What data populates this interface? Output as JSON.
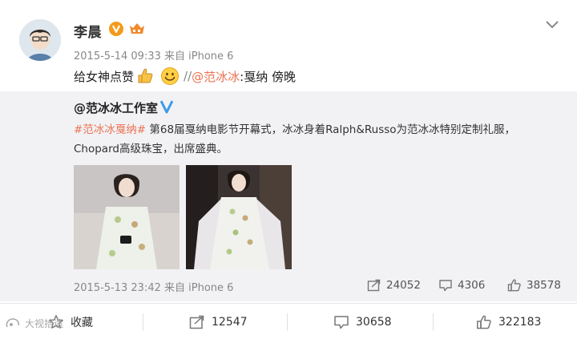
{
  "post": {
    "author": "李晨",
    "meta": "2015-5-14 09:33 来自 iPhone 6",
    "text_before": "给女神点赞",
    "text_slashes": "//",
    "mention": "@范冰冰",
    "text_after": ":戛纳 傍晚",
    "icons": [
      "vip-v-badge",
      "member-badge",
      "thumbs-up-emoji",
      "smile-emoji",
      "chevron-down-icon"
    ]
  },
  "repost": {
    "author": "@范冰冰工作室",
    "hashtag": "#范冰冰戛纳#",
    "text": "第68届戛纳电影节开幕式，冰冰身着Ralph&Russo为范冰冰特别定制礼服，Chopard高级珠宝，出席盛典。",
    "meta": "2015-5-13 23:42 来自 iPhone 6",
    "forwards": "24052",
    "comments": "4306",
    "likes": "38578"
  },
  "actions": {
    "favorite_label": "收藏",
    "forwards": "12547",
    "comments": "30658",
    "likes": "322183"
  },
  "watermark": "大视拾遗",
  "colors": {
    "accent": "#eb7350",
    "verify_blue": "#3d9be9",
    "vip_orange": "#f39a1a",
    "repost_bg": "#f2f2f5"
  }
}
